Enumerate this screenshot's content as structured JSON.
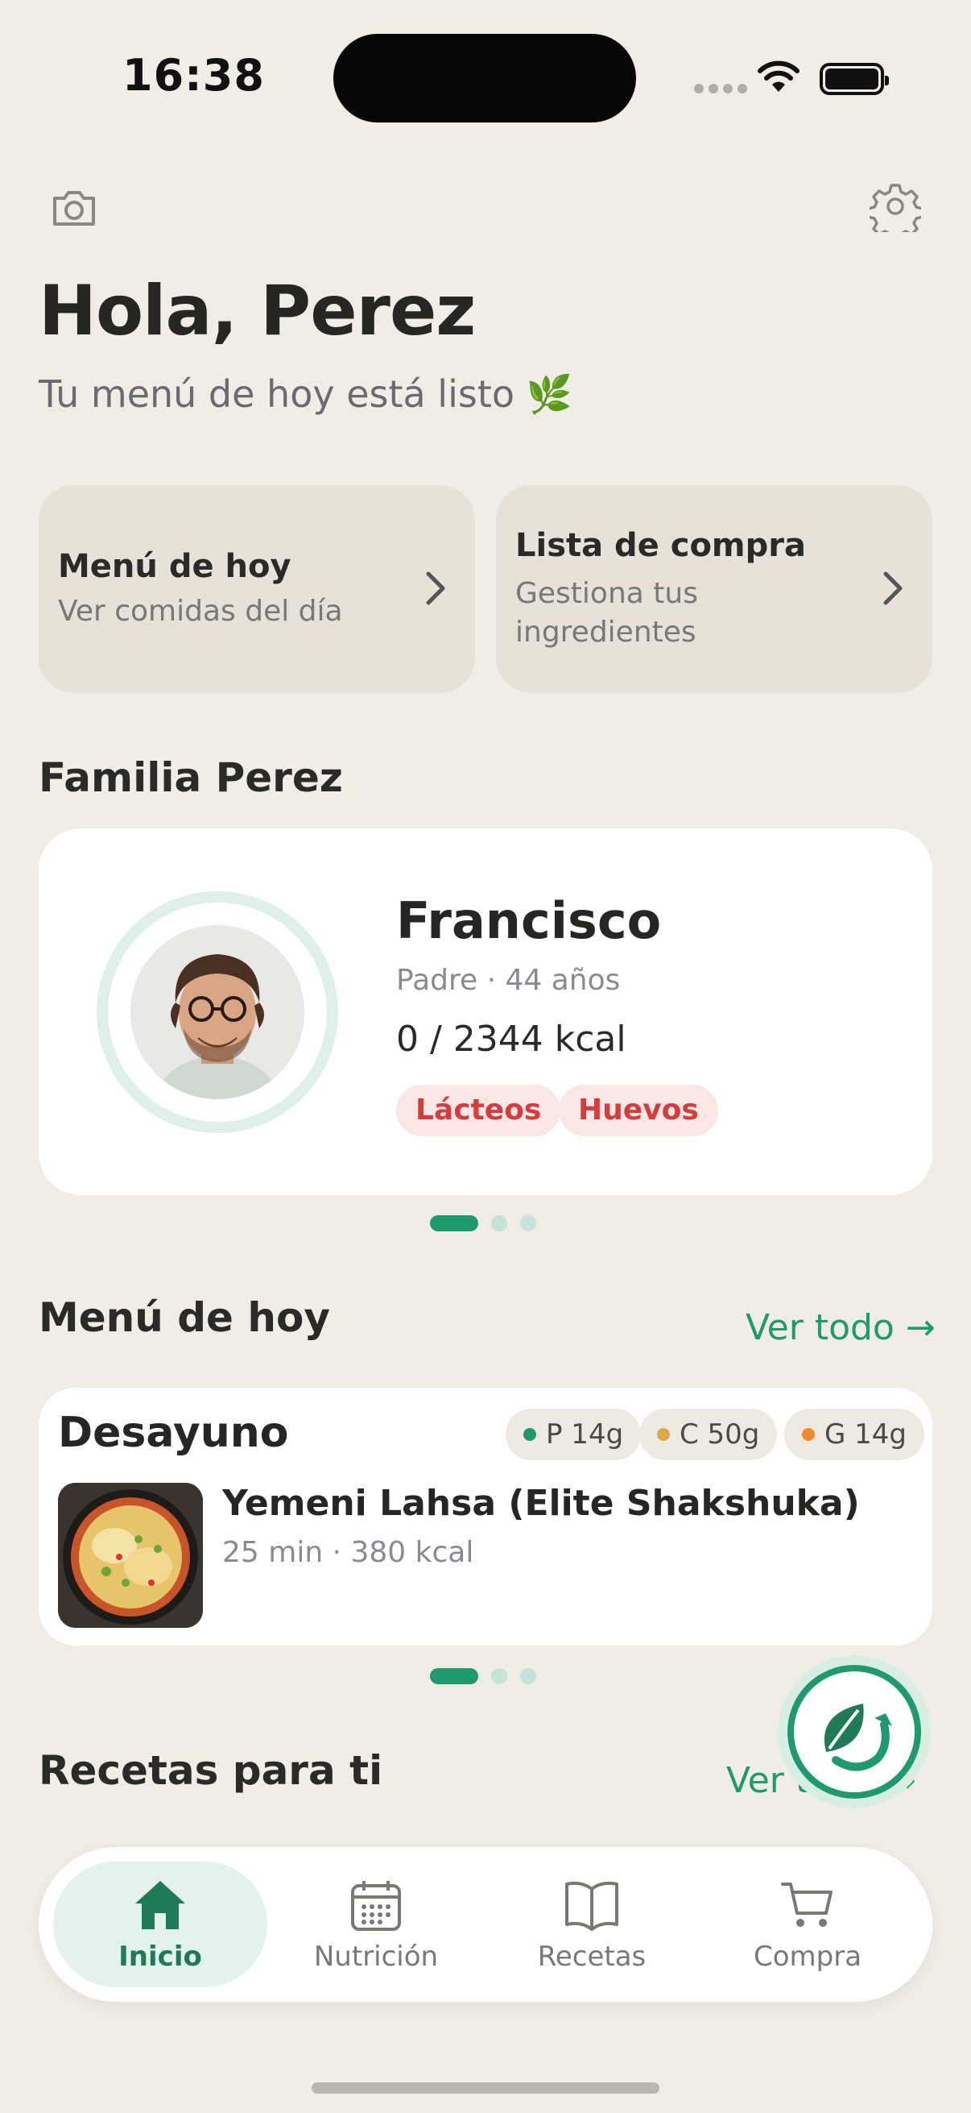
{
  "status_bar": {
    "time": "16:38"
  },
  "header": {
    "greeting": "Hola, Perez",
    "subtitle": "Tu menú de hoy está listo 🌿"
  },
  "quick_cards": [
    {
      "title": "Menú de hoy",
      "subtitle": "Ver comidas del día"
    },
    {
      "title": "Lista de compra",
      "subtitle_line1": "Gestiona tus",
      "subtitle_line2": "ingredientes"
    }
  ],
  "family": {
    "title": "Familia Perez",
    "member": {
      "name": "Francisco",
      "meta": "Padre · 44 años",
      "kcal": "0 / 2344 kcal",
      "tags": [
        "Lácteos",
        "Huevos"
      ]
    }
  },
  "menu_today": {
    "title": "Menú de hoy",
    "see_all": "Ver todo →",
    "meal": {
      "label": "Desayuno",
      "macros": [
        {
          "text": "P 14g",
          "color": "#1f9a6e"
        },
        {
          "text": "C 50g",
          "color": "#e0a94a"
        },
        {
          "text": "G 14g",
          "color": "#ef8a2e"
        }
      ],
      "name": "Yemeni Lahsa (Elite Shakshuka)",
      "meta": "25 min · 380 kcal"
    }
  },
  "recipes": {
    "title": "Recetas para ti",
    "see_all": "Ver todo →"
  },
  "tabbar": {
    "items": [
      {
        "label": "Inicio",
        "icon": "home-icon",
        "active": true
      },
      {
        "label": "Nutrición",
        "icon": "calendar-icon",
        "active": false
      },
      {
        "label": "Recetas",
        "icon": "book-icon",
        "active": false
      },
      {
        "label": "Compra",
        "icon": "cart-icon",
        "active": false
      }
    ]
  },
  "colors": {
    "accent": "#1f9a6e",
    "background": "#f0ede6",
    "allergen_text": "#d63c3c",
    "allergen_bg": "#fbe6e6"
  }
}
